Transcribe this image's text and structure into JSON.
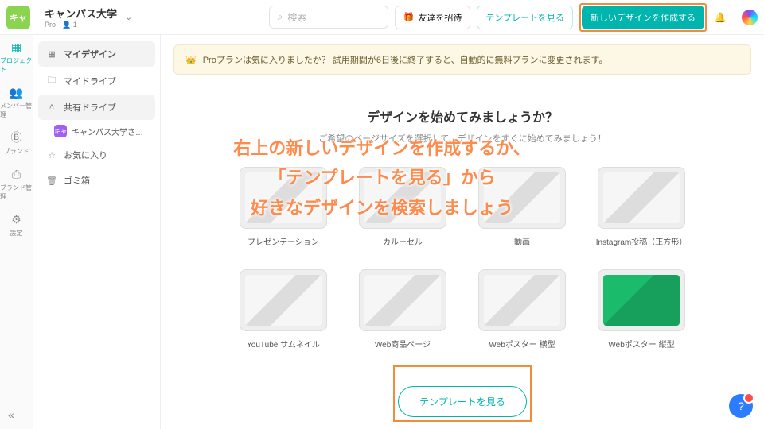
{
  "topbar": {
    "brand_badge": "キャ",
    "workspace_title": "キャンパス大学",
    "workspace_sub": "Pro · 👤 1",
    "search_placeholder": "検索",
    "invite_label": "友達を招待",
    "templates_label": "テンプレートを見る",
    "new_design_label": "新しいデザインを作成する"
  },
  "rail": {
    "items": [
      {
        "icon": "▦",
        "label": "プロジェクト",
        "active": true
      },
      {
        "icon": "👥",
        "label": "メンバー管理"
      },
      {
        "icon": "Ⓑ",
        "label": "ブランド"
      },
      {
        "icon": "⎙",
        "label": "ブランド管理"
      },
      {
        "icon": "⚙",
        "label": "設定"
      }
    ]
  },
  "sidebar": {
    "items": [
      {
        "icon": "⊞",
        "label": "マイデザイン",
        "active": true
      },
      {
        "icon": "🗀",
        "label": "マイドライブ"
      },
      {
        "icon": "˄",
        "label": "共有ドライブ",
        "expandable": true
      },
      {
        "icon": "☆",
        "label": "お気に入り"
      },
      {
        "icon": "🗑",
        "label": "ゴミ箱"
      }
    ],
    "shared_sub_badge": "キャ",
    "shared_sub_label": "キャンパス大学さまの共…"
  },
  "banner": {
    "text": "Proプランは気に入りましたか？ 試用期間が6日後に終了すると、自動的に無料プランに変更されます。"
  },
  "hero": {
    "title": "デザインを始めてみましょうか？",
    "subtitle": "ご希望のページサイズを選択して、デザインをすぐに始めてみましょう！"
  },
  "cards_row1": [
    {
      "label": "プレゼンテーション"
    },
    {
      "label": "カルーセル"
    },
    {
      "label": "動画"
    },
    {
      "label": "Instagram投稿（正方形）"
    }
  ],
  "cards_row2": [
    {
      "label": "YouTube サムネイル"
    },
    {
      "label": "Web商品ページ"
    },
    {
      "label": "Webポスター 横型"
    },
    {
      "label": "Webポスター 縦型",
      "green": true
    }
  ],
  "see_templates": "テンプレートを見る",
  "overlay": {
    "line1": "右上の新しいデザインを作成するか、",
    "line2": "「テンプレートを見る」から",
    "line3": "好きなデザインを検索しましょう"
  },
  "help_badge": "1"
}
